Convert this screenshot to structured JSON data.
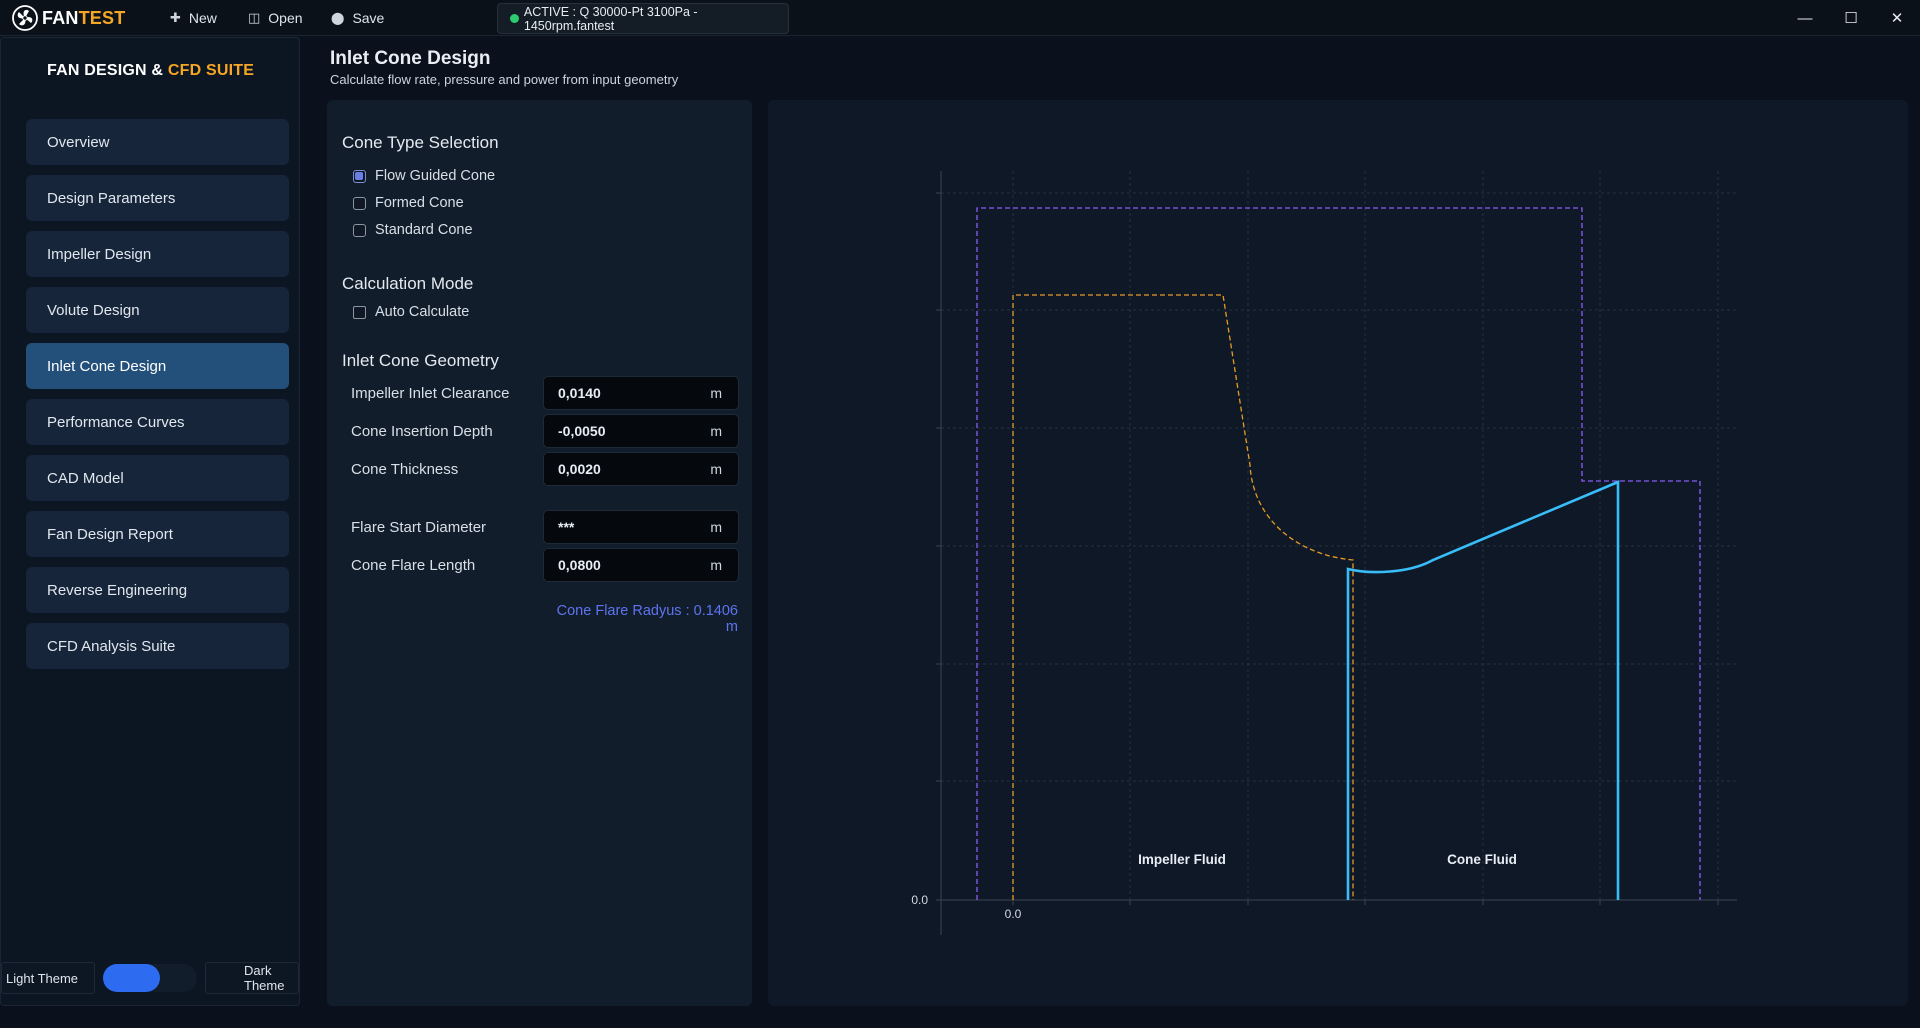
{
  "app": {
    "logo_a": "FAN",
    "logo_b": "TEST",
    "toolbar": {
      "new_label": "New",
      "open_label": "Open",
      "save_label": "Save"
    },
    "active_file": "ACTIVE : Q 30000-Pt 3100Pa - 1450rpm.fantest",
    "window": {
      "minimize": "—",
      "maximize": "☐",
      "close": "✕"
    }
  },
  "sidebar": {
    "brand_a": "FAN DESIGN & ",
    "brand_b": "CFD SUITE",
    "items": [
      {
        "label": "Overview",
        "active": false
      },
      {
        "label": "Design Parameters",
        "active": false
      },
      {
        "label": "Impeller Design",
        "active": false
      },
      {
        "label": "Volute Design",
        "active": false
      },
      {
        "label": "Inlet Cone Design",
        "active": true
      },
      {
        "label": "Performance Curves",
        "active": false
      },
      {
        "label": "CAD Model",
        "active": false
      },
      {
        "label": "Fan Design Report",
        "active": false
      },
      {
        "label": "Reverse Engineering",
        "active": false
      },
      {
        "label": "CFD Analysis Suite",
        "active": false
      }
    ],
    "theme": {
      "light_label": "Light Theme",
      "dark_label": "Dark Theme"
    }
  },
  "header": {
    "title": "Inlet Cone Design",
    "subtitle": "Calculate flow rate, pressure and power from input geometry"
  },
  "cone_type": {
    "heading": "Cone Type Selection",
    "options": [
      {
        "label": "Flow Guided Cone",
        "checked": true
      },
      {
        "label": "Formed Cone",
        "checked": false
      },
      {
        "label": "Standard Cone",
        "checked": false
      }
    ]
  },
  "calc_mode": {
    "heading": "Calculation Mode",
    "auto_label": "Auto Calculate",
    "auto_checked": false
  },
  "geometry": {
    "heading": "Inlet Cone Geometry",
    "fields": [
      {
        "label": "Impeller Inlet Clearance",
        "value": "0,0140",
        "unit": "m"
      },
      {
        "label": "Cone Insertion Depth",
        "value": "-0,0050",
        "unit": "m"
      },
      {
        "label": "Cone Thickness",
        "value": "0,0020",
        "unit": "m"
      },
      {
        "label": "Flare Start Diameter",
        "value": "***",
        "unit": "m"
      },
      {
        "label": "Cone Flare Length",
        "value": "0,0800",
        "unit": "m"
      }
    ],
    "flare_radius_text": "Cone Flare Radyus : 0.1406 m"
  },
  "chart": {
    "x_origin_label": "0.0",
    "y_origin_label": "0.0",
    "label_impeller": "Impeller Fluid",
    "label_cone": "Cone Fluid",
    "colors": {
      "purple": "#8b5cf6",
      "orange": "#e89b22",
      "cyan": "#38bdf8",
      "grid": "#26303d",
      "axis": "#2a3441"
    }
  }
}
